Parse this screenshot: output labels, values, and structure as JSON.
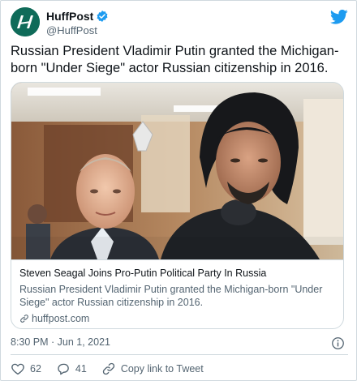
{
  "account": {
    "display_name": "HuffPost",
    "handle": "@HuffPost",
    "verified": true,
    "avatar_icon": "huffpost-logo",
    "brand_color": "#0f6b59"
  },
  "tweet": {
    "text": "Russian President Vladimir Putin granted the Michigan-born \"Under Siege\" actor Russian citizenship in 2016."
  },
  "card": {
    "image_icon": "photo-two-men",
    "title": "Steven Seagal Joins Pro-Putin Political Party In Russia",
    "description": "Russian President Vladimir Putin granted the Michigan-born \"Under Siege\" actor Russian citizenship in 2016.",
    "domain": "huffpost.com"
  },
  "meta": {
    "timestamp": "8:30 PM · Jun 1, 2021"
  },
  "actions": {
    "likes": "62",
    "replies": "41",
    "copy_link_label": "Copy link to Tweet"
  },
  "colors": {
    "twitter_blue": "#1d9bf0",
    "like_red": "#e0245e",
    "muted": "#536471"
  }
}
